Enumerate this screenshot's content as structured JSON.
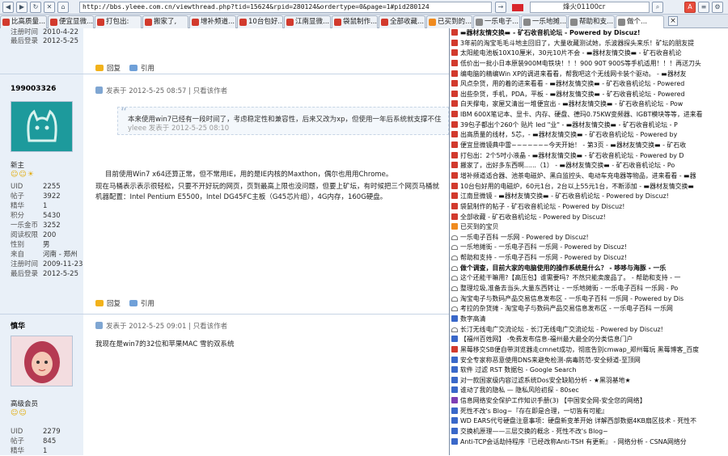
{
  "browser": {
    "url": "http://bbs.yleee.com.cn/viewthread.php?tid=15624&rpid=280124&ordertype=0&page=1#pid280124",
    "search_value": "烽火01100cr",
    "tabs": [
      "比高质量...",
      "便宜显微...",
      "打包出:",
      "搬家了,",
      "增补频道...",
      "10台包好...",
      "江南显微...",
      "袋鼠制作...",
      "全部收藏...",
      "已买到的...",
      "一乐电子...",
      "一乐地摊...",
      "帮助和支...",
      "做个..."
    ]
  },
  "left": {
    "top_info": [
      {
        "label": "注册时间",
        "value": "2010-4-22"
      },
      {
        "label": "最后登录",
        "value": "2012-5-25"
      }
    ],
    "user1": {
      "name": "199003326",
      "rank": "新主",
      "smiles": "☺☺☀",
      "stats": [
        {
          "label": "UID",
          "value": "2255"
        },
        {
          "label": "帖子",
          "value": "3922"
        },
        {
          "label": "精华",
          "value": "1"
        },
        {
          "label": "积分",
          "value": "5430"
        },
        {
          "label": "一乐金币",
          "value": "3252"
        },
        {
          "label": "阅读权限",
          "value": "200"
        },
        {
          "label": "性别",
          "value": "男"
        },
        {
          "label": "来自",
          "value": "河南 - 郑州"
        },
        {
          "label": "注册时间",
          "value": "2009-11-23"
        },
        {
          "label": "最后登录",
          "value": "2012-5-25"
        }
      ]
    },
    "user2": {
      "name": "慎华",
      "rank": "高级会员",
      "smiles": "☺☺",
      "stats": [
        {
          "label": "UID",
          "value": "2279"
        },
        {
          "label": "帖子",
          "value": "845"
        },
        {
          "label": "精华",
          "value": "1"
        }
      ]
    }
  },
  "posts": {
    "reply_label": "回复",
    "quote_label": "引用",
    "p1_header": "发表于 2012-5-25 08:57 | 只看该作者",
    "p1_quote": "本来使用win7已经有一段时间了，考虑稳定性和兼容性，后来又改为xp，但使用一年后系统就支撑不住",
    "p1_quote_sub": "yleee 发表于 2012-5-25 08:10",
    "p1_body": [
      "目前使用Win7 x64还算正常，但不常用IE，用的是IE内核的Maxthon，偶尔也用用Chrome。",
      "现在马桶表示表示很轻松，只要不开好玩的网页，页到最高上限也没问题，但要上矿坛，有时候把三个网页马桶就",
      "机器配置：Intel Pentium E5500，Intel DG45FC主板（G45芯片组），4G内存，160G硬盘。"
    ],
    "p2_header": "发表于 2012-5-25 09:01 | 只看该作者",
    "p2_body": "我现在是win7的32位和苹果MAC 雪豹双系统"
  },
  "history": [
    {
      "icon": "red",
      "text": "▬器材友情交换▬ - 矿石收音机论坛 - Powered by Discuz!"
    },
    {
      "icon": "red",
      "text": "3年前的淘宝毛毛斗地主回旧了，大量收藏测试她，乐波器探头来乐！矿坛的朋友提"
    },
    {
      "icon": "red",
      "text": "太阳能电池板10X10厘米，30元10片不会 - ▬器材友情交换▬ - 矿石收音机论"
    },
    {
      "icon": "red",
      "text": "低价出一批小日本原装900M电铁块！！！900 90T 900S等手机适用！！！再送刀头"
    },
    {
      "icon": "red",
      "text": "编电脑的精编Win XP的调进来看看，帮我吧这个无线网卡装个驱动。 - ▬器材友"
    },
    {
      "icon": "red",
      "text": "风点杂货，用的着的进来看看 - ▬器材友情交换▬ - 矿石收音机论坛 - Powered"
    },
    {
      "icon": "red",
      "text": "出些杂货，手机，PDA，平板 - ▬器材友情交换▬ - 矿石收音机论坛 - Powered"
    },
    {
      "icon": "red",
      "text": "白天撑电，家屋又清出一堆便宜出 - ▬器材友情交换▬ - 矿石收音机论坛 - Pow"
    },
    {
      "icon": "red",
      "text": "IBM 600X笔记本、显卡、内存、硬盘、德玛0.75KW变频器、IGBT模块等等，进来看"
    },
    {
      "icon": "red",
      "text": "39包子都出个260个 贴片 led \"业\" - ▬器材友情交换▬ - 矿石收音机论坛 - P"
    },
    {
      "icon": "red",
      "text": "出高质量的线材，5芯，- ▬器材友情交换▬ - 矿石收音机论坛 - Powered by"
    },
    {
      "icon": "red",
      "text": "便宜显微镜典中雷~~~~~~~今天开始！ - 第3页 - ▬器材友情交换▬ - 矿石收"
    },
    {
      "icon": "red",
      "text": "打包出：2个5吋小液晶 - ▬器材友情交换▬ - 矿石收音机论坛 - Powered by D"
    },
    {
      "icon": "red",
      "text": "搬家了，出好多东西啊......（1） - ▬器材友情交换▬ - 矿石收音机论坛 - Po"
    },
    {
      "icon": "red",
      "text": "增补频道适合器、池茶电磁炉、黑白监控头、电动车充电器等物品，进来看看 - ▬器"
    },
    {
      "icon": "red",
      "text": "10台包好用的电磁炉，60元1台，2台以上55元1台，不断添加 - ▬器材友情交换▬"
    },
    {
      "icon": "red",
      "text": "江南显微镜 - ▬器材友情交换▬ - 矿石收音机论坛 - Powered by Discuz!"
    },
    {
      "icon": "red",
      "text": "袋鼠制作的帖子 - 矿石收音机论坛 - Powered by Discuz!"
    },
    {
      "icon": "red",
      "text": "全部收藏 - 矿石收音机论坛 - Powered by Discuz!"
    },
    {
      "icon": "orange",
      "text": "已买到的宝贝"
    },
    {
      "icon": "wifi",
      "text": "一乐电子百科 一乐网 - Powered by Discuz!"
    },
    {
      "icon": "wifi",
      "text": "一乐地摊街 - 一乐电子百科 一乐网 - Powered by Discuz!"
    },
    {
      "icon": "wifi",
      "text": "帮助和支持 - 一乐电子百科 一乐网 - Powered by Discuz!"
    },
    {
      "icon": "wifi",
      "text": "做个调查，目前大家的电脑使用的操作系统是什么？ - 哆哆与海豚 - 一乐"
    },
    {
      "icon": "wifi",
      "text": "这个还能干嘛用?【高压包】谁需要吗？不然只能卖废品了。 - 帮助和支持 - 一"
    },
    {
      "icon": "wifi",
      "text": "整理垃圾,准备去当头,大量东西转让 - 一乐地摊街 - 一乐电子百科 一乐网 - Po"
    },
    {
      "icon": "wifi",
      "text": "淘宝电子与数码产品交易信息发布区 - 一乐电子百科 一乐网 - Powered by Dis"
    },
    {
      "icon": "wifi",
      "text": "考拉的杂货摊 - 淘宝电子与数码产品交易信息发布区 - 一乐电子百科 一乐网"
    },
    {
      "icon": "blue",
      "text": "数字高清"
    },
    {
      "icon": "wifi",
      "text": "长汀无线电广交流论坛 - 长汀无线电广交流论坛 - Powered by Discuz!"
    },
    {
      "icon": "blue",
      "text": "【福州百姓网】 -免费发布信息-福州最大最全的分类信息门户"
    },
    {
      "icon": "red",
      "text": "黑莓移交SB便自带浏览器走cmnet成功，彻底告别cmwap_郑州莓玩 黑莓博客_百度"
    },
    {
      "icon": "blue",
      "text": "安全专家称恶意使用DNS来避免检测-病毒防范-安全频道-至顶网"
    },
    {
      "icon": "blue",
      "text": "软件 过滤 RST 数据包 - Google Search"
    },
    {
      "icon": "blue",
      "text": "对一款国家级内容过滤系统Dos安全缺陷分析 - ★黑羽基地★"
    },
    {
      "icon": "blue",
      "text": "谁动了我的隐私 — 隐私风险初探 - 80sec"
    },
    {
      "icon": "purple",
      "text": "信息网络安全保护工作知识手册(3) 【中国安全网-安全您的网络】"
    },
    {
      "icon": "blue",
      "text": "死性不改's Blog~『存在即是合理，一切皆有可能』"
    },
    {
      "icon": "blue",
      "text": "WD EARS代号硬盘注意事项：硬盘新变革开始 详解西部数据4KB扇区技术 - 死性不"
    },
    {
      "icon": "blue",
      "text": "交换机原理——三层交换的概念 - 死性不改's Blog~"
    },
    {
      "icon": "blue",
      "text": "Anti-TCP会话劫持程序『已经改称Anti-TSH 有更新』 - 网络分析 - CSNA网络分"
    }
  ]
}
